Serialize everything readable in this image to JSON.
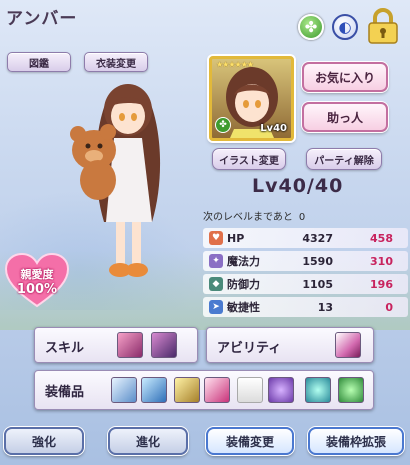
{
  "character": {
    "name": "アンバー",
    "level_text": "Lv40/40",
    "portrait_level": "Lv40",
    "stars": "★★★★★★"
  },
  "top_buttons": {
    "zukan": "図鑑",
    "costume": "衣装変更"
  },
  "side_buttons": {
    "favorite": "お気に入り",
    "helper": "助っ人",
    "illust_change": "イラスト変更",
    "party_release": "パーティ解除"
  },
  "next_level": {
    "label": "次のレベルまであと",
    "value": "0"
  },
  "stats": [
    {
      "icon": "heart-icon",
      "label": "HP",
      "base": "4327",
      "bonus": "458",
      "color": "#e0704a"
    },
    {
      "icon": "magic-icon",
      "label": "魔法力",
      "base": "1590",
      "bonus": "310",
      "color": "#8a6fc4"
    },
    {
      "icon": "shield-icon",
      "label": "防御力",
      "base": "1105",
      "bonus": "196",
      "color": "#4a8a7a"
    },
    {
      "icon": "agility-icon",
      "label": "敏捷性",
      "base": "13",
      "bonus": "0",
      "color": "#4a7bd0"
    }
  ],
  "affection": {
    "label": "親愛度",
    "value": "100%"
  },
  "panels": {
    "skill": "スキル",
    "ability": "アビリティ",
    "equipment": "装備品"
  },
  "bottom_buttons": {
    "enhance": "強化",
    "evolve": "進化",
    "equip_change": "装備変更",
    "equip_expand": "装備枠拡張"
  },
  "colors": {
    "accent_pink": "#c8235e",
    "title_purple": "#4a3a55",
    "portrait_frame_gold": "#e2b93a"
  }
}
